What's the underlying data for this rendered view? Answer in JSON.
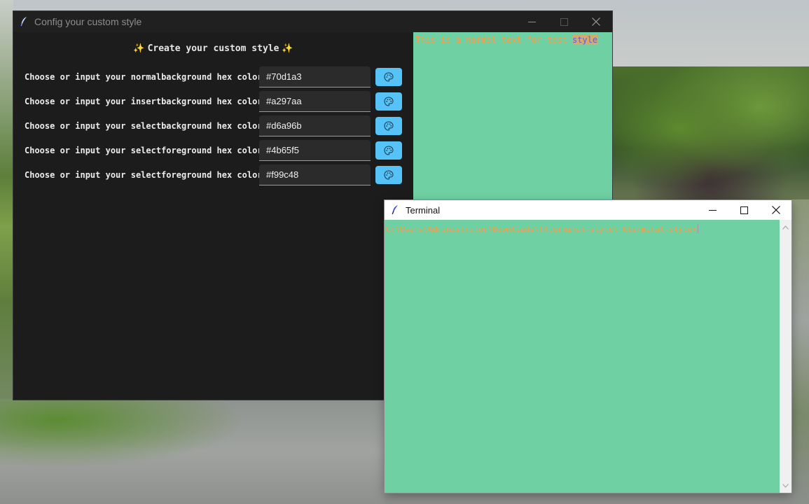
{
  "config_window": {
    "title": "Config your custom style",
    "heading": "Create your custom style",
    "rows": [
      {
        "label": "Choose or input your normalbackground hex color",
        "value": "#70d1a3"
      },
      {
        "label": "Choose or input your insertbackground hex color",
        "value": "#a297aa"
      },
      {
        "label": "Choose or input your selectbackground hex color",
        "value": "#d6a96b"
      },
      {
        "label": "Choose or input your selectforeground hex color",
        "value": "#4b65f5"
      },
      {
        "label": "Choose or input your selectforeground hex color",
        "value": "#f99c48"
      }
    ],
    "preview": {
      "normal_text": "This is a normal text for test ",
      "selected_text": "style"
    }
  },
  "terminal_window": {
    "title": "Terminal",
    "prompt": "C:\\Users\\Administrator\\Downloads\\TKterminal-style\\TKterminal-style>"
  },
  "colors": {
    "normal_background": "#70d1a3",
    "insert_background": "#a297aa",
    "select_background": "#d6a96b",
    "select_foreground": "#4b65f5",
    "foreground": "#f99c48",
    "button_accent": "#55c3f7"
  },
  "icons": {
    "app": "feather-icon",
    "color_picker": "palette-icon",
    "heading_decoration": "sparkle-icon"
  }
}
